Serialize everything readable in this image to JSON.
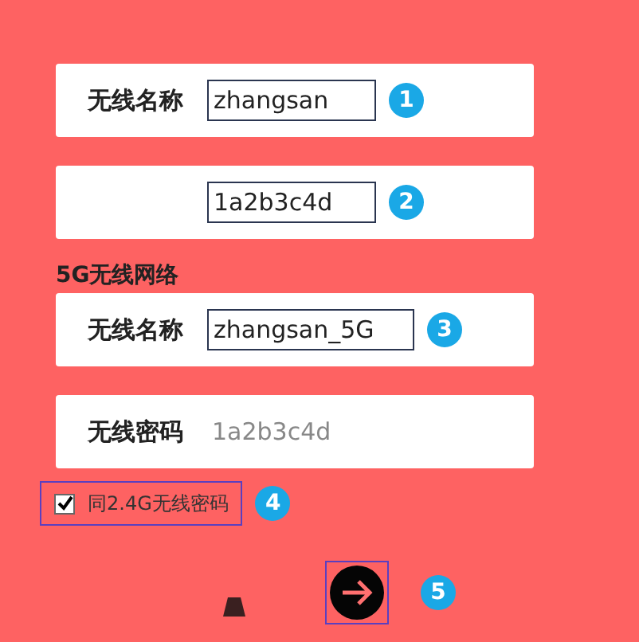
{
  "rows_24g": [
    {
      "label": "无线名称",
      "value": "zhangsan",
      "kind": "boxed",
      "callout": "1"
    },
    {
      "value": "1a2b3c4d",
      "kind": "boxed",
      "callout": "2"
    }
  ],
  "section_5g": {
    "heading": "5G无线网络",
    "rows": [
      {
        "label": "无线名称",
        "value": "zhangsan_5G",
        "kind": "boxed",
        "callout": "3"
      },
      {
        "label": "无线密码",
        "value": "1a2b3c4d",
        "kind": "plain"
      }
    ]
  },
  "same_password": {
    "label": "同2.4G无线密码",
    "checked": true,
    "callout": "4"
  },
  "next": {
    "callout": "5"
  }
}
